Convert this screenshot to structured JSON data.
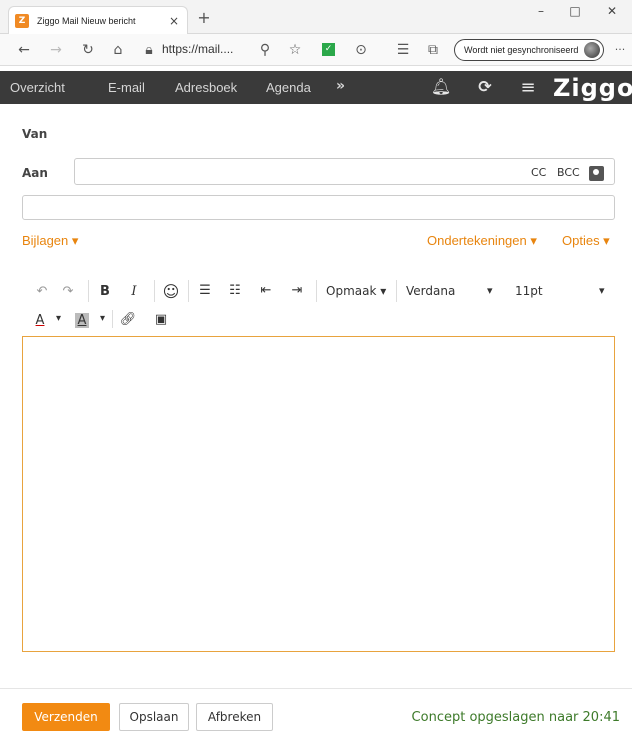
{
  "browser": {
    "tab_title": "Ziggo Mail Nieuw bericht",
    "tab_favicon_letter": "Z",
    "url": "https://mail....",
    "sync_label": "Wordt niet gesynchroniseerd",
    "win_min": "–",
    "win_max": "□",
    "win_close": "✕",
    "tab_close": "×",
    "new_tab": "+",
    "more": "···"
  },
  "appnav": {
    "items": [
      "Overzicht",
      "E-mail",
      "Adresboek",
      "Agenda"
    ],
    "more": "»",
    "logo": "Ziggo"
  },
  "compose": {
    "from_label": "Van",
    "to_label": "Aan",
    "cc": "CC",
    "bcc": "BCC",
    "to_value": "",
    "subject_value": ""
  },
  "links": {
    "attachments": "Bijlagen ▾",
    "signatures": "Ondertekeningen ▾",
    "options": "Opties ▾"
  },
  "toolbar": {
    "undo": "↶",
    "redo": "↷",
    "bold": "B",
    "italic": "I",
    "emoji": "☺",
    "format": "Opmaak ▾",
    "font": "Verdana",
    "font_caret": "▾",
    "size": "11pt",
    "size_caret": "▾",
    "text_color": "A",
    "bg_color": "A",
    "caret": "▾"
  },
  "footer": {
    "send": "Verzenden",
    "save": "Opslaan",
    "cancel": "Afbreken",
    "status": "Concept opgeslagen naar 20:41"
  },
  "colors": {
    "accent": "#f28a12",
    "nav_bg": "#3a3a3a",
    "status_green": "#3d7a2a"
  }
}
